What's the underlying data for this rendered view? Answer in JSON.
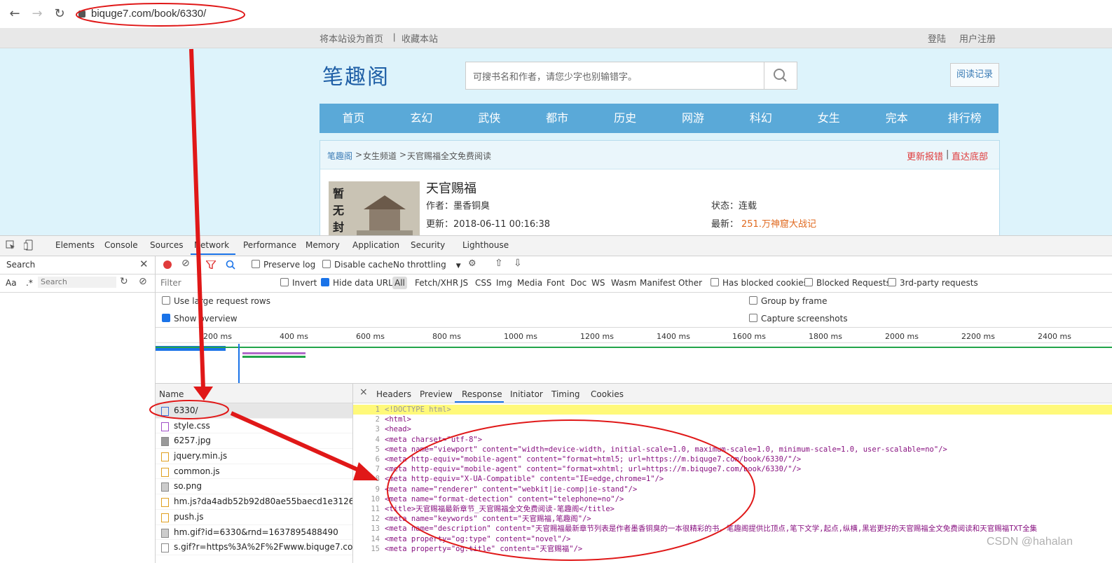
{
  "browser": {
    "url": "biquge7.com/book/6330/"
  },
  "site": {
    "top_links": {
      "set_home": "将本站设为首页",
      "divider": "|",
      "bookmark": "收藏本站",
      "login": "登陆",
      "register": "用户注册"
    },
    "logo": "笔趣阁",
    "search_placeholder": "可搜书名和作者，请您少字也别输错字。",
    "reading_record": "阅读记录",
    "nav": [
      "首页",
      "玄幻",
      "武侠",
      "都市",
      "历史",
      "网游",
      "科幻",
      "女生",
      "完本",
      "排行榜"
    ],
    "breadcrumb": {
      "home": "笔趣阁",
      "sep1": ">",
      "channel": "女生频道",
      "sep2": ">",
      "current": "天官赐福全文免费阅读"
    },
    "report": "更新报错",
    "report_sep": "|",
    "to_bottom": "直达底部",
    "book": {
      "cover_text": "暂无封",
      "title": "天官赐福",
      "author": "作者：墨香铜臭",
      "status": "状态：连载",
      "updated": "更新：2018-06-11 00:16:38",
      "latest_label": "最新：",
      "latest_chapter": "251.万神窟大战记"
    }
  },
  "devtools": {
    "tabs": [
      "Elements",
      "Console",
      "Sources",
      "Network",
      "Performance",
      "Memory",
      "Application",
      "Security",
      "Lighthouse"
    ],
    "search_panel": {
      "title": "Search",
      "aa": "Aa",
      "regex": ".*",
      "placeholder": "Search"
    },
    "toolbar": {
      "preserve_log": "Preserve log",
      "disable_cache": "Disable cache",
      "throttling": "No throttling"
    },
    "filter": {
      "placeholder": "Filter",
      "invert": "Invert",
      "hide_data_urls": "Hide data URLs",
      "types": [
        "All",
        "Fetch/XHR",
        "JS",
        "CSS",
        "Img",
        "Media",
        "Font",
        "Doc",
        "WS",
        "Wasm",
        "Manifest",
        "Other"
      ],
      "blocked_cookies": "Has blocked cookies",
      "blocked_requests": "Blocked Requests",
      "third_party": "3rd-party requests"
    },
    "settings": {
      "large_rows": "Use large request rows",
      "overview": "Show overview",
      "group_by_frame": "Group by frame",
      "capture_screenshots": "Capture screenshots"
    },
    "timeline_ticks": [
      "200 ms",
      "400 ms",
      "600 ms",
      "800 ms",
      "1000 ms",
      "1200 ms",
      "1400 ms",
      "1600 ms",
      "1800 ms",
      "2000 ms",
      "2200 ms",
      "2400 ms"
    ],
    "requests": {
      "header": "Name",
      "items": [
        "6330/",
        "style.css",
        "6257.jpg",
        "jquery.min.js",
        "common.js",
        "so.png",
        "hm.js?da4adb52b92d80ae55baecd1e3126f1e",
        "push.js",
        "hm.gif?id=6330&rnd=1637895488490",
        "s.gif?r=https%3A%2F%2Fwww.biquge7.com%..."
      ]
    },
    "detail_tabs": [
      "Headers",
      "Preview",
      "Response",
      "Initiator",
      "Timing",
      "Cookies"
    ],
    "response_lines": [
      "<!DOCTYPE html>",
      "<html>",
      "<head>",
      "<meta charset=\"utf-8\">",
      "<meta name=\"viewport\" content=\"width=device-width, initial-scale=1.0, maximum-scale=1.0, minimum-scale=1.0, user-scalable=no\"/>",
      "<meta http-equiv=\"mobile-agent\" content=\"format=html5; url=https://m.biquge7.com/book/6330/\"/>",
      "<meta http-equiv=\"mobile-agent\" content=\"format=xhtml; url=https://m.biquge7.com/book/6330/\"/>",
      "<meta http-equiv=\"X-UA-Compatible\" content=\"IE=edge,chrome=1\"/>",
      "<meta name=\"renderer\" content=\"webkit|ie-comp|ie-stand\"/>",
      "<meta name=\"format-detection\" content=\"telephone=no\"/>",
      "<title>天官赐福最新章节_天官赐福全文免费阅读-笔趣阁</title>",
      "<meta name=\"keywords\" content=\"天官赐福,笔趣阁\"/>",
      "<meta name=\"description\" content=\"天官赐福最新章节列表是作者墨香铜臭的一本很精彩的书，笔趣阁提供比顶点,笔下文学,起点,纵横,黑岩更好的天官赐福全文免费阅读和天官赐福TXT全集",
      "<meta property=\"og:type\" content=\"novel\"/>",
      "<meta property=\"og:title\" content=\"天官赐福\"/>"
    ]
  },
  "watermark": "CSDN @hahalan"
}
